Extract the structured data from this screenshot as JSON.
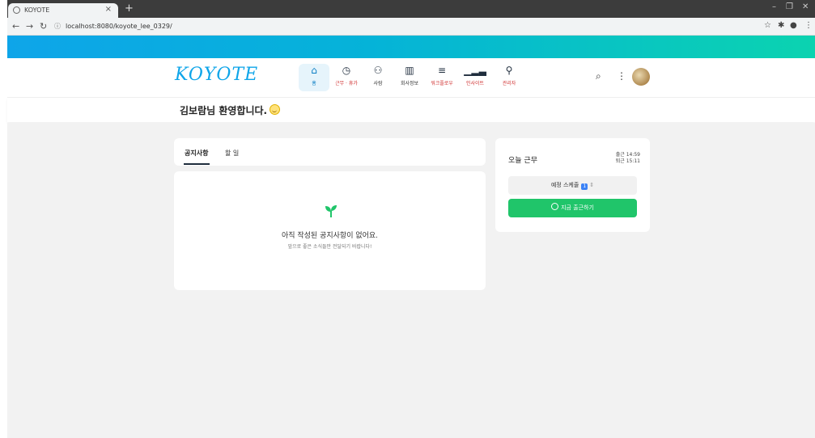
{
  "browser": {
    "tab_title": "KOYOTE",
    "tab_close": "×",
    "new_tab": "+",
    "url": "localhost:8080/koyote_lee_0329/",
    "window_controls": {
      "minimize": "–",
      "restore": "❐",
      "close": "✕"
    }
  },
  "header": {
    "logo": "KOYOTE",
    "menu": [
      {
        "icon": "home-icon",
        "label": "홈"
      },
      {
        "icon": "clock-icon",
        "label": "근무 · 휴가"
      },
      {
        "icon": "people-icon",
        "label": "사람"
      },
      {
        "icon": "building-icon",
        "label": "회사정보"
      },
      {
        "icon": "list-icon",
        "label": "워크플로우"
      },
      {
        "icon": "signal-icon",
        "label": "인사이트"
      },
      {
        "icon": "wrench-icon",
        "label": "관리자"
      }
    ],
    "accent_color": "#0ea5e9"
  },
  "welcome": {
    "text": "김보람님 환영합니다."
  },
  "tabs": [
    {
      "label": "공지사항"
    },
    {
      "label": "할 일"
    }
  ],
  "notice": {
    "empty_title": "아직 작성된 공지사항이 없어요.",
    "empty_subtitle": "앞으로 좋은 소식들만 전달되기 바랍니다!"
  },
  "work": {
    "title": "오늘 근무",
    "clock_in_time": "출근 14:59",
    "clock_out_time": "퇴근 15:11",
    "schedule_label": "예정 스케줄",
    "schedule_count": "1",
    "clock_in_button": "지금 출근하기",
    "button_color": "#20c56a"
  }
}
